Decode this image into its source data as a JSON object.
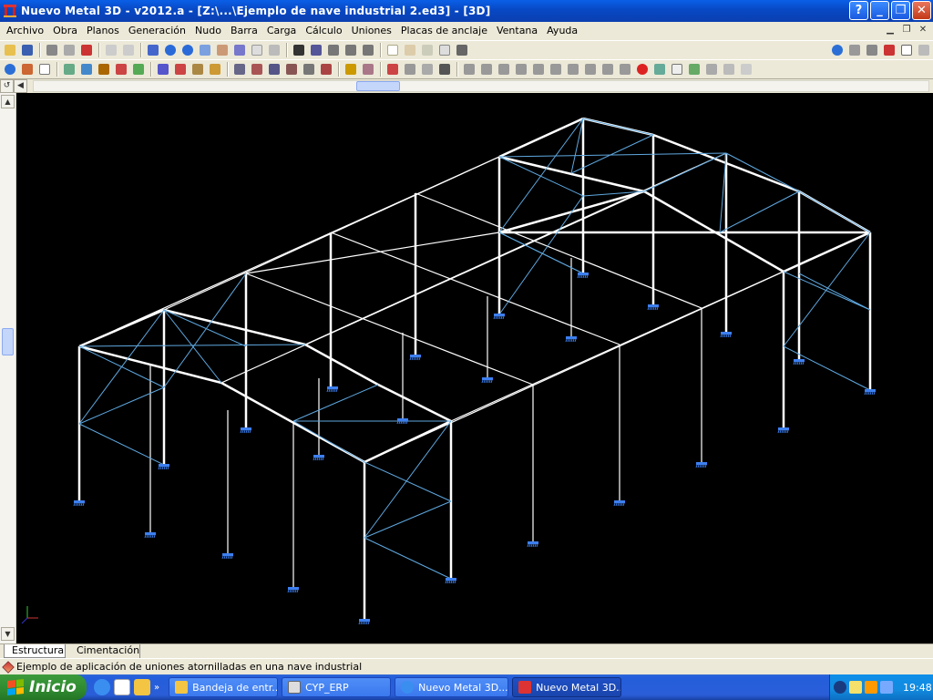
{
  "window": {
    "title": "Nuevo Metal 3D - v2012.a - [Z:\\...\\Ejemplo de nave industrial 2.ed3] - [3D]"
  },
  "titlebar_buttons": {
    "help": "?",
    "minimize": "_",
    "restore": "❐",
    "close": "✕"
  },
  "menu": [
    "Archivo",
    "Obra",
    "Planos",
    "Generación",
    "Nudo",
    "Barra",
    "Carga",
    "Cálculo",
    "Uniones",
    "Placas de anclaje",
    "Ventana",
    "Ayuda"
  ],
  "tabs": {
    "estructura": "Estructura",
    "cimentacion": "Cimentación"
  },
  "status": {
    "text": "Ejemplo de aplicación de uniones atornilladas en una nave industrial"
  },
  "taskbar": {
    "start": "Inicio",
    "tasks": [
      {
        "label": "Bandeja de entr..."
      },
      {
        "label": "CYP_ERP"
      },
      {
        "label": "Nuevo Metal 3D..."
      },
      {
        "label": "Nuevo Metal 3D..."
      }
    ],
    "clock": "19:48"
  },
  "colors": {
    "view_background": "#000000",
    "frame_members": "#ffffff",
    "bracing": "#5fa8e0",
    "supports": "#3c7ff0"
  }
}
